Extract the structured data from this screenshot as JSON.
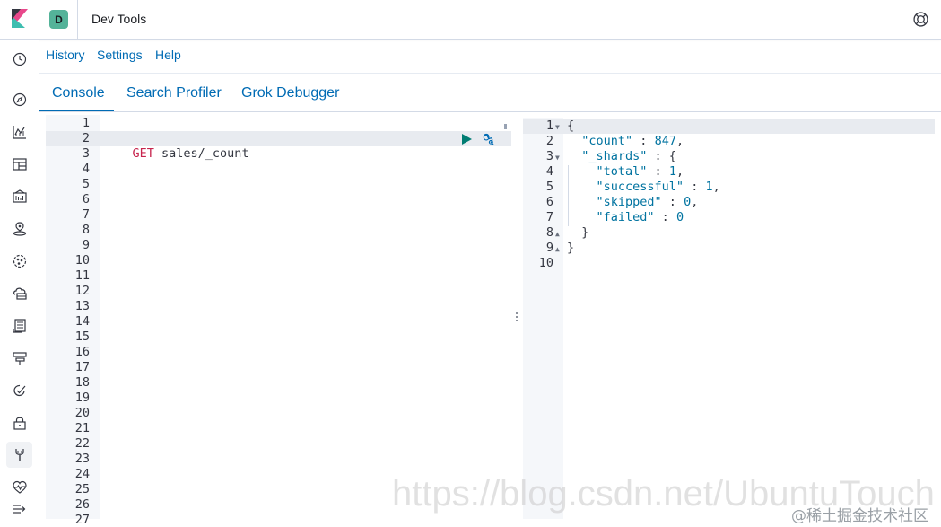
{
  "header": {
    "space_initial": "D",
    "app_title": "Dev Tools"
  },
  "sidenav": {
    "items": [
      {
        "icon": "clock-icon",
        "label": "Recently viewed"
      },
      {
        "icon": "compass-icon",
        "label": "Discover"
      },
      {
        "icon": "visualize-icon",
        "label": "Visualize"
      },
      {
        "icon": "dashboard-icon",
        "label": "Dashboard"
      },
      {
        "icon": "canvas-icon",
        "label": "Canvas"
      },
      {
        "icon": "maps-icon",
        "label": "Maps"
      },
      {
        "icon": "ml-icon",
        "label": "Machine Learning"
      },
      {
        "icon": "infrastructure-icon",
        "label": "Infrastructure"
      },
      {
        "icon": "logs-icon",
        "label": "Logs"
      },
      {
        "icon": "apm-icon",
        "label": "APM"
      },
      {
        "icon": "uptime-icon",
        "label": "Uptime"
      },
      {
        "icon": "siem-icon",
        "label": "SIEM"
      },
      {
        "icon": "devtools-icon",
        "label": "Dev Tools"
      },
      {
        "icon": "monitoring-icon",
        "label": "Stack Monitoring"
      },
      {
        "icon": "collapse-menu-icon",
        "label": "Collapse"
      }
    ]
  },
  "topmenu": {
    "history": "History",
    "settings": "Settings",
    "help": "Help"
  },
  "tabs": {
    "console": "Console",
    "search_profiler": "Search Profiler",
    "grok_debugger": "Grok Debugger"
  },
  "request_editor": {
    "line_count": 27,
    "active_line": 2,
    "method": "GET",
    "path": " sales/_count"
  },
  "response_editor": {
    "lines": [
      "{",
      "  \"count\" : 847,",
      "  \"_shards\" : {",
      "    \"total\" : 1,",
      "    \"successful\" : 1,",
      "    \"skipped\" : 0,",
      "    \"failed\" : 0",
      "  }",
      "}",
      ""
    ]
  },
  "watermark": {
    "url": "https://blog.csdn.net/UbuntuTouch",
    "cn": "@稀土掘金技术社区"
  },
  "colors": {
    "accent": "#006bb4",
    "method": "#c7254e",
    "json_key": "#0073a0",
    "run_button": "#017d73"
  }
}
